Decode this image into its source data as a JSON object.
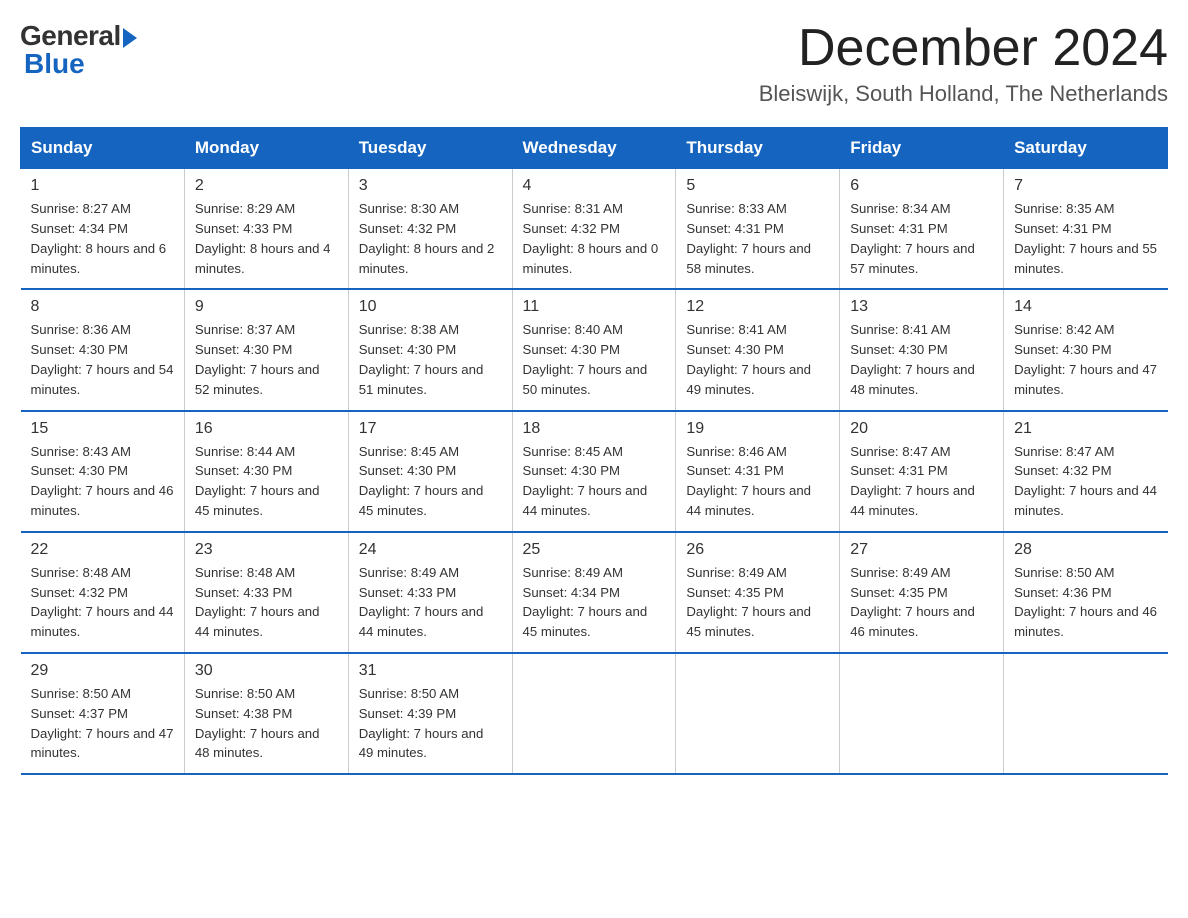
{
  "logo": {
    "general": "General",
    "blue": "Blue"
  },
  "title": "December 2024",
  "location": "Bleiswijk, South Holland, The Netherlands",
  "days_of_week": [
    "Sunday",
    "Monday",
    "Tuesday",
    "Wednesday",
    "Thursday",
    "Friday",
    "Saturday"
  ],
  "weeks": [
    [
      {
        "day": "1",
        "sunrise": "8:27 AM",
        "sunset": "4:34 PM",
        "daylight": "8 hours and 6 minutes."
      },
      {
        "day": "2",
        "sunrise": "8:29 AM",
        "sunset": "4:33 PM",
        "daylight": "8 hours and 4 minutes."
      },
      {
        "day": "3",
        "sunrise": "8:30 AM",
        "sunset": "4:32 PM",
        "daylight": "8 hours and 2 minutes."
      },
      {
        "day": "4",
        "sunrise": "8:31 AM",
        "sunset": "4:32 PM",
        "daylight": "8 hours and 0 minutes."
      },
      {
        "day": "5",
        "sunrise": "8:33 AM",
        "sunset": "4:31 PM",
        "daylight": "7 hours and 58 minutes."
      },
      {
        "day": "6",
        "sunrise": "8:34 AM",
        "sunset": "4:31 PM",
        "daylight": "7 hours and 57 minutes."
      },
      {
        "day": "7",
        "sunrise": "8:35 AM",
        "sunset": "4:31 PM",
        "daylight": "7 hours and 55 minutes."
      }
    ],
    [
      {
        "day": "8",
        "sunrise": "8:36 AM",
        "sunset": "4:30 PM",
        "daylight": "7 hours and 54 minutes."
      },
      {
        "day": "9",
        "sunrise": "8:37 AM",
        "sunset": "4:30 PM",
        "daylight": "7 hours and 52 minutes."
      },
      {
        "day": "10",
        "sunrise": "8:38 AM",
        "sunset": "4:30 PM",
        "daylight": "7 hours and 51 minutes."
      },
      {
        "day": "11",
        "sunrise": "8:40 AM",
        "sunset": "4:30 PM",
        "daylight": "7 hours and 50 minutes."
      },
      {
        "day": "12",
        "sunrise": "8:41 AM",
        "sunset": "4:30 PM",
        "daylight": "7 hours and 49 minutes."
      },
      {
        "day": "13",
        "sunrise": "8:41 AM",
        "sunset": "4:30 PM",
        "daylight": "7 hours and 48 minutes."
      },
      {
        "day": "14",
        "sunrise": "8:42 AM",
        "sunset": "4:30 PM",
        "daylight": "7 hours and 47 minutes."
      }
    ],
    [
      {
        "day": "15",
        "sunrise": "8:43 AM",
        "sunset": "4:30 PM",
        "daylight": "7 hours and 46 minutes."
      },
      {
        "day": "16",
        "sunrise": "8:44 AM",
        "sunset": "4:30 PM",
        "daylight": "7 hours and 45 minutes."
      },
      {
        "day": "17",
        "sunrise": "8:45 AM",
        "sunset": "4:30 PM",
        "daylight": "7 hours and 45 minutes."
      },
      {
        "day": "18",
        "sunrise": "8:45 AM",
        "sunset": "4:30 PM",
        "daylight": "7 hours and 44 minutes."
      },
      {
        "day": "19",
        "sunrise": "8:46 AM",
        "sunset": "4:31 PM",
        "daylight": "7 hours and 44 minutes."
      },
      {
        "day": "20",
        "sunrise": "8:47 AM",
        "sunset": "4:31 PM",
        "daylight": "7 hours and 44 minutes."
      },
      {
        "day": "21",
        "sunrise": "8:47 AM",
        "sunset": "4:32 PM",
        "daylight": "7 hours and 44 minutes."
      }
    ],
    [
      {
        "day": "22",
        "sunrise": "8:48 AM",
        "sunset": "4:32 PM",
        "daylight": "7 hours and 44 minutes."
      },
      {
        "day": "23",
        "sunrise": "8:48 AM",
        "sunset": "4:33 PM",
        "daylight": "7 hours and 44 minutes."
      },
      {
        "day": "24",
        "sunrise": "8:49 AM",
        "sunset": "4:33 PM",
        "daylight": "7 hours and 44 minutes."
      },
      {
        "day": "25",
        "sunrise": "8:49 AM",
        "sunset": "4:34 PM",
        "daylight": "7 hours and 45 minutes."
      },
      {
        "day": "26",
        "sunrise": "8:49 AM",
        "sunset": "4:35 PM",
        "daylight": "7 hours and 45 minutes."
      },
      {
        "day": "27",
        "sunrise": "8:49 AM",
        "sunset": "4:35 PM",
        "daylight": "7 hours and 46 minutes."
      },
      {
        "day": "28",
        "sunrise": "8:50 AM",
        "sunset": "4:36 PM",
        "daylight": "7 hours and 46 minutes."
      }
    ],
    [
      {
        "day": "29",
        "sunrise": "8:50 AM",
        "sunset": "4:37 PM",
        "daylight": "7 hours and 47 minutes."
      },
      {
        "day": "30",
        "sunrise": "8:50 AM",
        "sunset": "4:38 PM",
        "daylight": "7 hours and 48 minutes."
      },
      {
        "day": "31",
        "sunrise": "8:50 AM",
        "sunset": "4:39 PM",
        "daylight": "7 hours and 49 minutes."
      },
      null,
      null,
      null,
      null
    ]
  ]
}
